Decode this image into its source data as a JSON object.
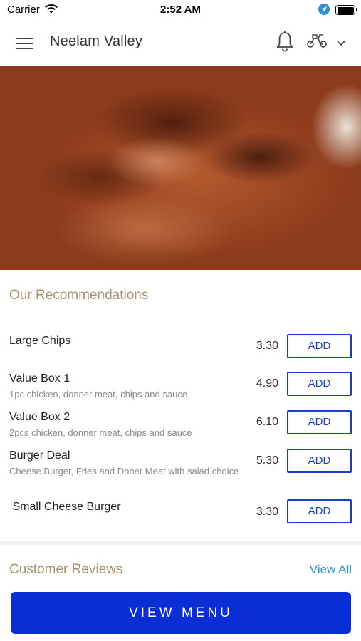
{
  "status_bar": {
    "carrier": "Carrier",
    "time": "2:52 AM",
    "icons": [
      "wifi-icon",
      "location-arrow-icon",
      "battery-icon"
    ]
  },
  "header": {
    "title": "Neelam Valley",
    "icons": [
      "hamburger-menu-icon",
      "bell-icon",
      "scooter-icon",
      "chevron-down-icon"
    ]
  },
  "recommendations": {
    "title": "Our Recommendations",
    "add_label": "ADD",
    "items": [
      {
        "name": "Large Chips",
        "description": "",
        "price": "3.30"
      },
      {
        "name": "Value Box 1",
        "description": "1pc chicken, donner meat, chips and sauce",
        "price": "4.90"
      },
      {
        "name": "Value Box 2",
        "description": "2pcs chicken, donner meat, chips and  sauce",
        "price": "6.10"
      },
      {
        "name": "Burger Deal",
        "description": "Cheese Burger, Fries and Doner Meat with salad choice",
        "price": "5.30"
      },
      {
        "name": " Small Cheese Burger",
        "description": "",
        "price": "3.30"
      }
    ]
  },
  "reviews": {
    "title": "Customer Reviews",
    "view_all_label": "View All"
  },
  "footer": {
    "view_menu_label": "VIEW MENU"
  },
  "colors": {
    "accent_blue": "#0a2ed6",
    "button_border": "#1a3fc7",
    "section_title": "#a9936b",
    "link": "#2d8fd5"
  }
}
